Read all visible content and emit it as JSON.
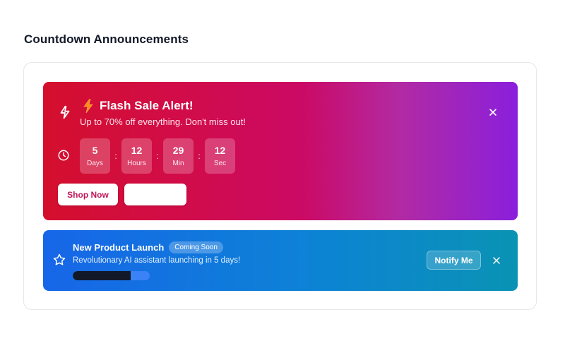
{
  "page": {
    "title": "Countdown Announcements"
  },
  "flash_sale": {
    "icon": "zap-icon",
    "title_icon": "lightning-bolt-icon",
    "title": "Flash Sale Alert!",
    "subtitle": "Up to 70% off everything. Don't miss out!",
    "timer_icon": "clock-icon",
    "countdown": [
      {
        "value": "5",
        "unit": "Days"
      },
      {
        "value": "12",
        "unit": "Hours"
      },
      {
        "value": "29",
        "unit": "Min"
      },
      {
        "value": "12",
        "unit": "Sec"
      }
    ],
    "separator": ":",
    "primary_button": "Shop Now",
    "secondary_button": "",
    "close_icon": "close-icon",
    "colors": {
      "start": "#d40f2d",
      "end": "#8a1fdc",
      "accent_text": "#c01658"
    }
  },
  "product_launch": {
    "icon": "star-icon",
    "title": "New Product Launch",
    "badge": "Coming Soon",
    "subtitle": "Revolutionary AI assistant launching in 5 days!",
    "progress": 0.75,
    "button": "Notify Me",
    "close_icon": "close-icon",
    "colors": {
      "start": "#1766e8",
      "end": "#0a93b4",
      "progress_fill": "#111827",
      "progress_track": "#3b82f6"
    }
  }
}
